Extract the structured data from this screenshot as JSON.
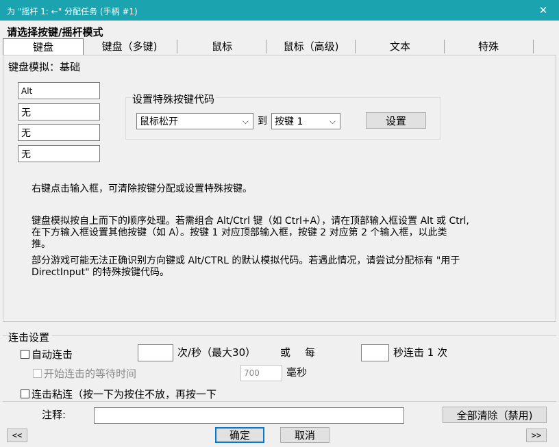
{
  "window": {
    "title": "为 \"摇杆 1: ←\" 分配任务 (手柄 #1)",
    "close_glyph": "✕"
  },
  "heading": "请选择按键/摇杆模式",
  "tabs": [
    {
      "label": "键盘",
      "active": true
    },
    {
      "label": "键盘（多键)"
    },
    {
      "label": "鼠标"
    },
    {
      "label": "鼠标（高级)"
    },
    {
      "label": "文本"
    },
    {
      "label": "特殊"
    }
  ],
  "keyboard_group": {
    "label": "键盘模拟：基础",
    "key_inputs": [
      "Alt",
      "无",
      "无",
      "无"
    ],
    "special": {
      "label": "设置特殊按键代码",
      "action_select": "鼠标松开",
      "to_label": "到",
      "key_select": "按键 1",
      "set_button": "设置"
    },
    "hint1": "右键点击输入框，可清除按键分配或设置特殊按键。",
    "hint2_line1": "键盘模拟按自上而下的顺序处理。若需组合 Alt/Ctrl 键（如 Ctrl+A），请在顶部输入框设置 Alt 或 Ctrl,",
    "hint2_line2": "在下方输入框设置其他按键（如 A）。按键 1 对应顶部输入框，按键 2 对应第 2 个输入框，以此类",
    "hint2_line3": "推。",
    "hint3_line1": "部分游戏可能无法正确识别方向键或 Alt/CTRL 的默认模拟代码。若遇此情况，请尝试分配标有 \"用于",
    "hint3_line2": "DirectInput\" 的特殊按键代码。"
  },
  "turbo": {
    "label": "连击设置",
    "auto_fire_label": "自动连击",
    "rate_value": "",
    "rate_unit": "次/秒（最大30）",
    "or_label": "或",
    "every_label": "每",
    "seconds_value": "",
    "seconds_unit": "秒连击 1 次",
    "delay_label": "开始连击的等待时间",
    "delay_value": "700",
    "delay_unit": "毫秒",
    "sticky_label": "连击粘连（按一下为按住不放，再按一下"
  },
  "footer": {
    "comment_label": "注释:",
    "comment_value": "",
    "clear_all_button": "全部清除（禁用)",
    "prev_button": "<<",
    "ok_button": "确定",
    "cancel_button": "取消",
    "next_button": ">>"
  }
}
